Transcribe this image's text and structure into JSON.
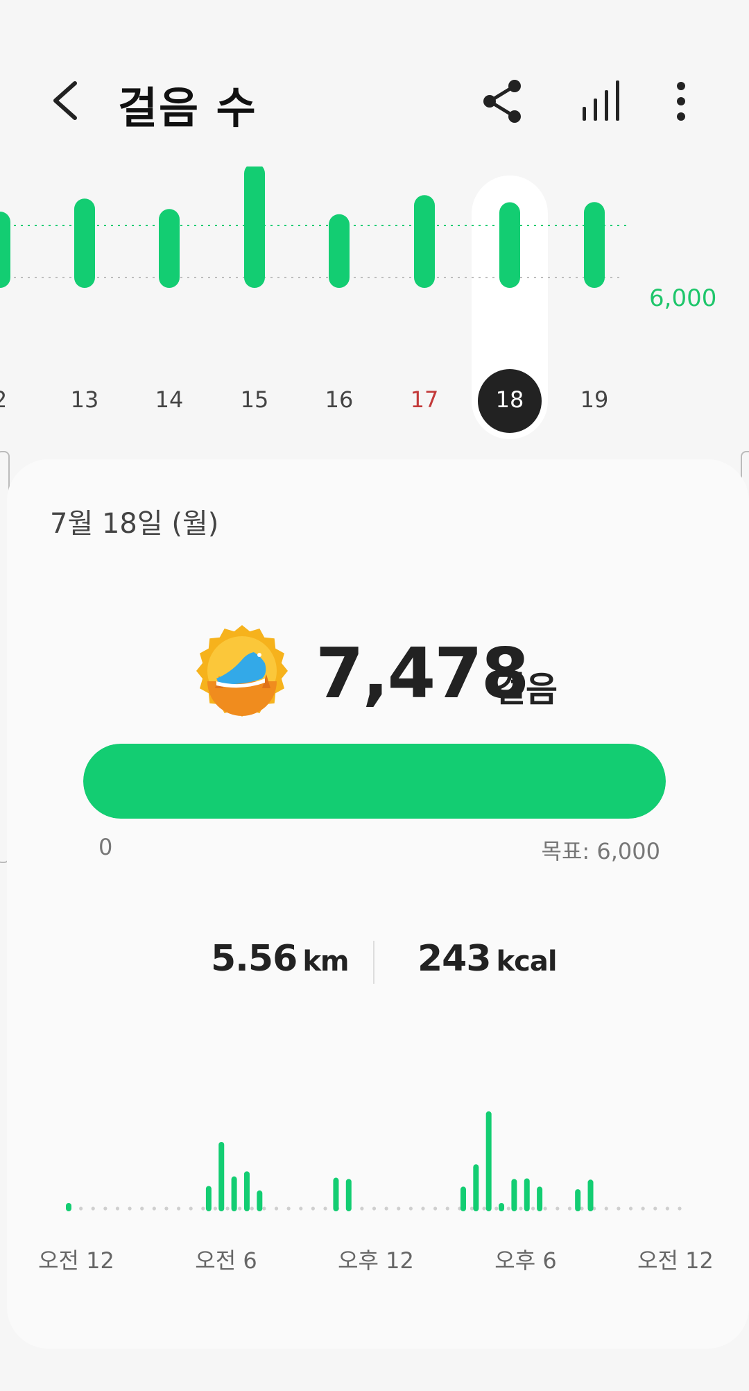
{
  "header": {
    "title": "걸음 수",
    "icons": [
      "back-icon",
      "share-icon",
      "bar-chart-icon",
      "more-vertical-icon"
    ]
  },
  "colors": {
    "accent": "#13cd72",
    "sunday": "#c33a3a",
    "selected_day_bg": "#222222",
    "background": "#f6f6f6"
  },
  "daily_chart": {
    "goal_label": "6,000",
    "days": [
      {
        "label": "2",
        "steps": 6400
      },
      {
        "label": "13",
        "steps": 7900
      },
      {
        "label": "14",
        "steps": 6700
      },
      {
        "label": "15",
        "steps": 12000
      },
      {
        "label": "16",
        "steps": 6100
      },
      {
        "label": "17",
        "steps": 8300,
        "sunday": true
      },
      {
        "label": "18",
        "steps": 7478,
        "selected": true
      },
      {
        "label": "19",
        "steps": 7500
      }
    ]
  },
  "summary": {
    "date": "7월 18일 (월)",
    "badge_icon": "running-shoe-badge-icon",
    "steps": "7,478",
    "steps_unit": "걸음",
    "progress": 1.0,
    "progress_min": "0",
    "progress_goal": "목표: 6,000",
    "distance_value": "5.56",
    "distance_unit": "km",
    "calories_value": "243",
    "calories_unit": "kcal"
  },
  "hourly_chart": {
    "x_labels": [
      "오전 12",
      "오전 6",
      "오후 12",
      "오후 6",
      "오전 12"
    ],
    "bars": [
      {
        "pos": 0.0,
        "v": 0.02
      },
      {
        "pos": 5.5,
        "v": 0.31
      },
      {
        "pos": 6.0,
        "v": 1.0
      },
      {
        "pos": 6.5,
        "v": 0.46
      },
      {
        "pos": 7.0,
        "v": 0.54
      },
      {
        "pos": 7.5,
        "v": 0.24
      },
      {
        "pos": 10.5,
        "v": 0.44
      },
      {
        "pos": 11.0,
        "v": 0.42
      },
      {
        "pos": 15.5,
        "v": 0.3
      },
      {
        "pos": 16.0,
        "v": 0.65
      },
      {
        "pos": 16.5,
        "v": 1.48
      },
      {
        "pos": 17.0,
        "v": 0.04
      },
      {
        "pos": 17.5,
        "v": 0.42
      },
      {
        "pos": 18.0,
        "v": 0.43
      },
      {
        "pos": 18.5,
        "v": 0.3
      },
      {
        "pos": 20.0,
        "v": 0.26
      },
      {
        "pos": 20.5,
        "v": 0.41
      }
    ]
  }
}
